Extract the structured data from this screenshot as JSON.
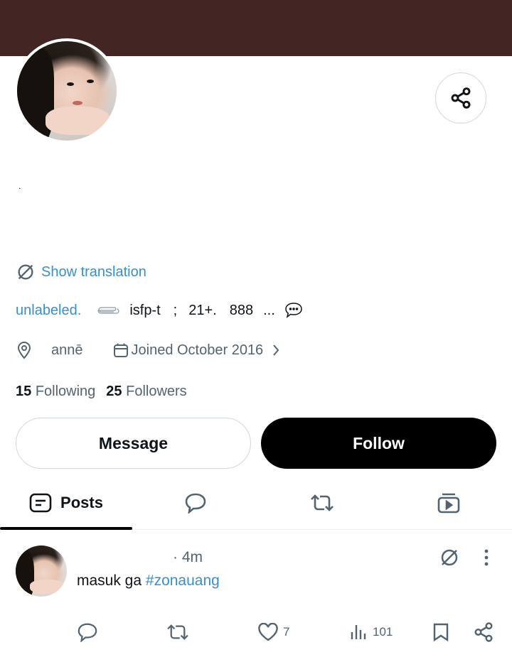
{
  "profile": {
    "bio_text": ".",
    "translate_label": "Show translation",
    "bio_line": {
      "link": "unlabeled.",
      "mbti": "isfp-t",
      "sep": ";",
      "age": "21+.",
      "num": "888",
      "ellipsis": "..."
    },
    "location": "annē",
    "joined": "Joined October 2016",
    "following_count": "15",
    "following_label": "Following",
    "followers_count": "25",
    "followers_label": "Followers"
  },
  "buttons": {
    "message": "Message",
    "follow": "Follow"
  },
  "tabs": {
    "posts": "Posts"
  },
  "post": {
    "time": "· 4m",
    "text": "masuk ga",
    "hashtag": "#zonauang",
    "likes": "7",
    "views": "101"
  },
  "colors": {
    "banner": "#432523",
    "link": "#3a8fc7",
    "follow_button": "#000000"
  },
  "icons": [
    "share-icon",
    "translate-icon",
    "paperclip-icon",
    "speech-bubble-icon",
    "location-icon",
    "calendar-icon",
    "chevron-right-icon",
    "posts-tab-icon",
    "replies-tab-icon",
    "reposts-tab-icon",
    "media-tab-icon",
    "more-icon",
    "reply-icon",
    "repost-icon",
    "like-icon",
    "views-icon",
    "bookmark-icon"
  ]
}
